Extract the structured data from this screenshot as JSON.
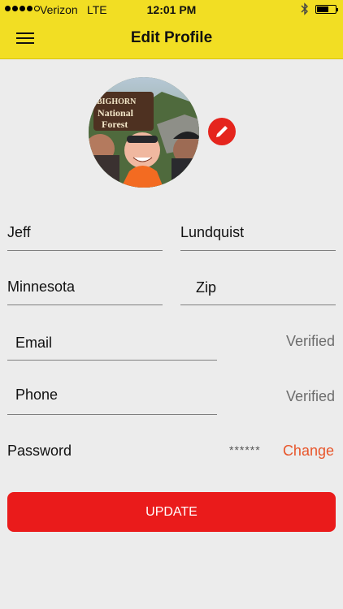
{
  "status_bar": {
    "carrier": "Verizon",
    "network": "LTE",
    "time": "12:01 PM",
    "signal_bars_filled": 4,
    "signal_bars_total": 5,
    "bluetooth_icon": "bluetooth-icon",
    "battery_icon": "battery-icon"
  },
  "nav": {
    "title": "Edit Profile",
    "menu_icon": "hamburger-menu-icon"
  },
  "profile": {
    "avatar_sign_text": [
      "BIGHORN",
      "National",
      "Forest"
    ],
    "edit_icon": "pencil-icon"
  },
  "form": {
    "first_name": "Jeff",
    "last_name": "Lundquist",
    "state": "Minnesota",
    "zip": "Zip",
    "email": "Email",
    "email_status": "Verified",
    "phone": "Phone",
    "phone_status": "Verified",
    "password_label": "Password",
    "password_mask": "******",
    "change_label": "Change"
  },
  "actions": {
    "update_label": "UPDATE"
  },
  "colors": {
    "header_yellow": "#f2de23",
    "accent_red": "#ea1b1b",
    "change_orange": "#e8552a",
    "background": "#ececec"
  }
}
